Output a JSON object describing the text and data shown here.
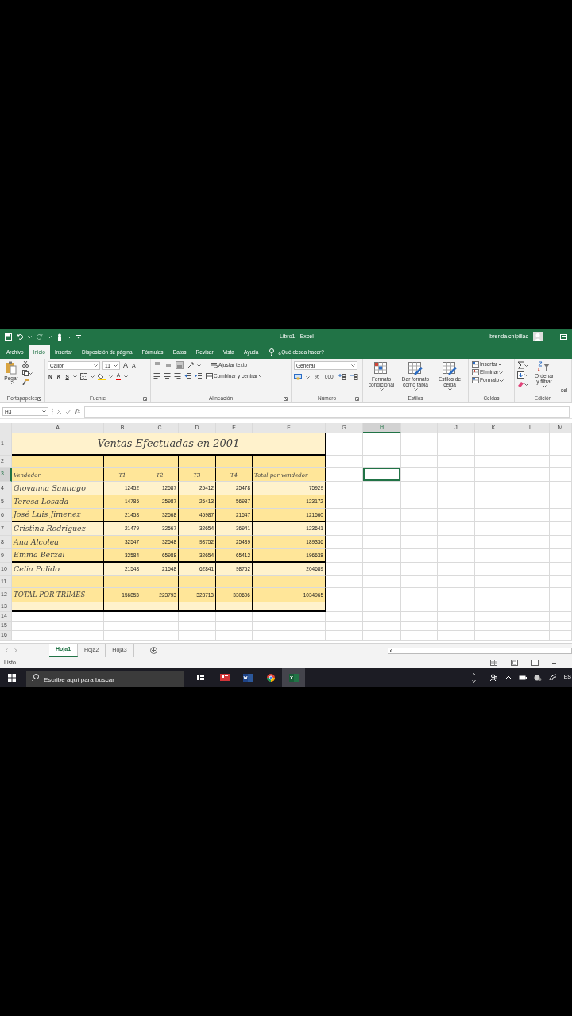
{
  "title_bar": {
    "title": "Libro1 - Excel",
    "user": "brenda chipillac"
  },
  "ribbon_tabs": [
    {
      "label": "Archivo",
      "selected": false
    },
    {
      "label": "Inicio",
      "selected": true
    },
    {
      "label": "Insertar",
      "selected": false
    },
    {
      "label": "Disposición de página",
      "selected": false
    },
    {
      "label": "Fórmulas",
      "selected": false
    },
    {
      "label": "Datos",
      "selected": false
    },
    {
      "label": "Revisar",
      "selected": false
    },
    {
      "label": "Vista",
      "selected": false
    },
    {
      "label": "Ayuda",
      "selected": false
    }
  ],
  "tell_me": {
    "placeholder": "¿Qué desea hacer?"
  },
  "ribbon": {
    "clipboard": {
      "paste": "Pegar",
      "label": "Portapapeles"
    },
    "font": {
      "name": "Calibri",
      "size": "11",
      "grow": "A",
      "shrink": "A",
      "bold": "N",
      "italic": "K",
      "underline": "S",
      "color_label": "A",
      "label": "Fuente"
    },
    "alignment": {
      "wrap": "Ajustar texto",
      "merge": "Combinar y centrar",
      "label": "Alineación"
    },
    "number": {
      "format": "General",
      "percent": "%",
      "thousands": "000",
      "label": "Número"
    },
    "styles": {
      "buttons": [
        "Formato condicional",
        "Dar formato como tabla",
        "Estilos de celda"
      ],
      "label": "Estilos"
    },
    "cells": {
      "buttons": [
        "Insertar",
        "Eliminar",
        "Formato"
      ],
      "label": "Celdas"
    },
    "editing": {
      "sort": "Ordenar y filtrar",
      "find": "sel",
      "label": "Edición"
    }
  },
  "formula_bar": {
    "name_box": "H3",
    "function_label": "fx"
  },
  "columns": [
    {
      "label": "A",
      "selected": false
    },
    {
      "label": "B",
      "selected": false
    },
    {
      "label": "C",
      "selected": false
    },
    {
      "label": "D",
      "selected": false
    },
    {
      "label": "E",
      "selected": false
    },
    {
      "label": "F",
      "selected": false
    },
    {
      "label": "G",
      "selected": false
    },
    {
      "label": "H",
      "selected": true
    },
    {
      "label": "I",
      "selected": false
    },
    {
      "label": "J",
      "selected": false
    },
    {
      "label": "K",
      "selected": false
    },
    {
      "label": "L",
      "selected": false
    },
    {
      "label": "M",
      "selected": false
    }
  ],
  "row_headers": [
    {
      "label": "1",
      "selected": false
    },
    {
      "label": "2",
      "selected": false
    },
    {
      "label": "3",
      "selected": true
    },
    {
      "label": "4",
      "selected": false
    },
    {
      "label": "5",
      "selected": false
    },
    {
      "label": "6",
      "selected": false
    },
    {
      "label": "7",
      "selected": false
    },
    {
      "label": "8",
      "selected": false
    },
    {
      "label": "9",
      "selected": false
    },
    {
      "label": "10",
      "selected": false
    },
    {
      "label": "11",
      "selected": false
    },
    {
      "label": "12",
      "selected": false
    },
    {
      "label": "13",
      "selected": false
    },
    {
      "label": "14",
      "selected": false
    },
    {
      "label": "15",
      "selected": false
    },
    {
      "label": "16",
      "selected": false
    }
  ],
  "rows": [
    {
      "kind": "title",
      "color": "#fff2cc",
      "ruled": true,
      "text": "Ventas Efectuadas en 2001"
    },
    {
      "kind": "blank",
      "color": "#ffe699",
      "ruled": false
    },
    {
      "kind": "header",
      "color": "#ffe699",
      "ruled": false,
      "cells": [
        "Vendedor",
        "T1",
        "T2",
        "T3",
        "T4",
        "Total por vendedor"
      ]
    },
    {
      "kind": "data",
      "color": "#fff2cc",
      "ruled": false,
      "cells": [
        "Giovanna Santiago",
        "12452",
        "12587",
        "25412",
        "25478",
        "75929"
      ]
    },
    {
      "kind": "data",
      "color": "#ffe699",
      "ruled": false,
      "cells": [
        "Teresa Losada",
        "14785",
        "25987",
        "25413",
        "56987",
        "123172"
      ]
    },
    {
      "kind": "data",
      "color": "#ffe699",
      "ruled": true,
      "cells": [
        "José Luis Jimenez",
        "21458",
        "32568",
        "45987",
        "21547",
        "121560"
      ]
    },
    {
      "kind": "data",
      "color": "#fff2cc",
      "ruled": false,
      "cells": [
        "Cristina Rodriguez",
        "21479",
        "32567",
        "32654",
        "36941",
        "123641"
      ]
    },
    {
      "kind": "data",
      "color": "#ffe699",
      "ruled": false,
      "cells": [
        "Ana Alcolea",
        "32547",
        "32548",
        "98752",
        "25489",
        "189336"
      ]
    },
    {
      "kind": "data",
      "color": "#ffe699",
      "ruled": true,
      "cells": [
        "Emma Berzal",
        "32584",
        "65988",
        "32654",
        "65412",
        "196638"
      ]
    },
    {
      "kind": "data",
      "color": "#fff2cc",
      "ruled": false,
      "cells": [
        "Celia Pulido",
        "21548",
        "21548",
        "62841",
        "98752",
        "204689"
      ]
    },
    {
      "kind": "blank",
      "color": "#ffe699",
      "ruled": false
    },
    {
      "kind": "total",
      "color": "#ffe699",
      "ruled": false,
      "cells": [
        "TOTAL POR TRIMES",
        "156853",
        "223793",
        "323713",
        "330606",
        "1034965"
      ]
    },
    {
      "kind": "spacer",
      "color": "#fff2cc",
      "ruled": true
    },
    {
      "kind": "empty"
    },
    {
      "kind": "empty"
    },
    {
      "kind": "empty"
    }
  ],
  "sheet_tabs": [
    {
      "label": "Hoja1",
      "selected": true
    },
    {
      "label": "Hoja2",
      "selected": false
    },
    {
      "label": "Hoja3",
      "selected": false
    }
  ],
  "status": "Listo",
  "taskbar": {
    "search": {
      "placeholder": "Escribe aquí para buscar"
    },
    "language": "ES"
  }
}
